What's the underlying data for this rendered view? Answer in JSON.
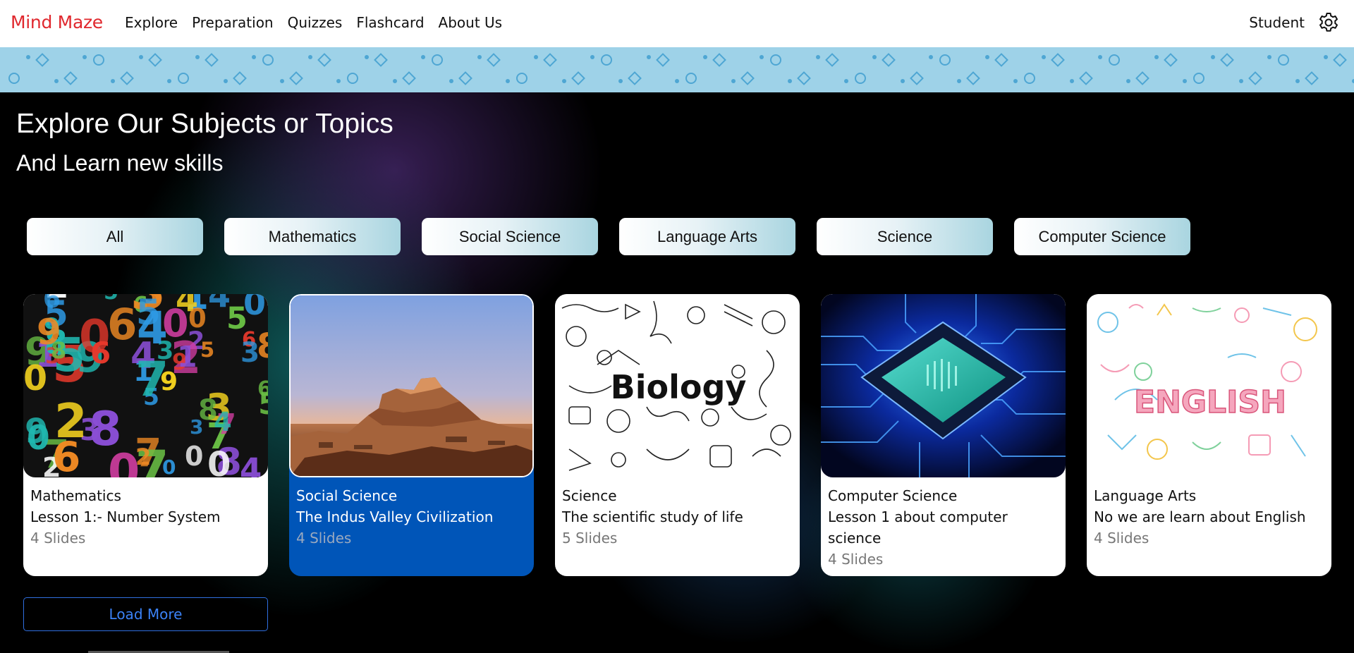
{
  "brand": "Mind Maze",
  "nav": {
    "links": [
      "Explore",
      "Preparation",
      "Quizzes",
      "Flashcard",
      "About Us"
    ],
    "user_label": "Student",
    "settings_icon": "gear-icon"
  },
  "hero": {
    "title": "Explore Our Subjects or Topics",
    "subtitle": "And Learn new skills"
  },
  "filters": [
    "All",
    "Mathematics",
    "Social Science",
    "Language Arts",
    "Science",
    "Computer Science"
  ],
  "cards": [
    {
      "subject": "Mathematics",
      "title": "Lesson 1:- Number System",
      "slides": "4 Slides",
      "image": "colorful-numbers",
      "active": false
    },
    {
      "subject": "Social Science",
      "title": "The Indus Valley Civilization",
      "slides": "4 Slides",
      "image": "ancient-ruins",
      "active": true
    },
    {
      "subject": "Science",
      "title": "The scientific study of life",
      "slides": "5 Slides",
      "image": "biology-doodles",
      "image_text": "Biology",
      "active": false
    },
    {
      "subject": "Computer Science",
      "title": "Lesson 1 about computer science",
      "slides": "4 Slides",
      "image": "circuit-chip",
      "active": false
    },
    {
      "subject": "Language Arts",
      "title": "No we are learn about English",
      "slides": "4 Slides",
      "image": "english-doodles",
      "image_text": "ENGLISH",
      "active": false
    }
  ],
  "load_more": "Load More",
  "colors": {
    "brand": "#e0282e",
    "active_card": "#0055b8",
    "load_more": "#3b82f6",
    "pattern_band": "#9ed2e8"
  }
}
